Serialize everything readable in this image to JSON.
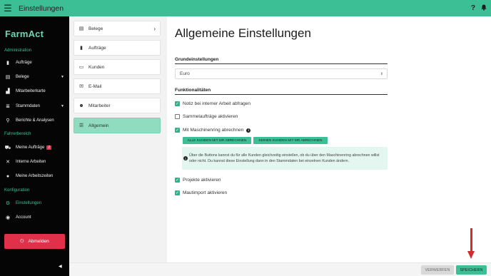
{
  "topbar": {
    "title": "Einstellungen",
    "help": "?"
  },
  "sidebar": {
    "logo": "FarmAct",
    "sections": [
      {
        "label": "Administration"
      },
      {
        "label": "Fahrerbereich"
      },
      {
        "label": "Konfiguration"
      }
    ],
    "items": [
      {
        "label": "Aufträge",
        "icon": "clipboard-icon"
      },
      {
        "label": "Belege",
        "icon": "document-icon"
      },
      {
        "label": "Mitarbeiterkarte",
        "icon": "map-icon"
      },
      {
        "label": "Stammdaten",
        "icon": "list-icon"
      },
      {
        "label": "Berichte & Analysen",
        "icon": "search-icon"
      },
      {
        "label": "Meine Aufträge",
        "icon": "tractor-icon",
        "badge": "2"
      },
      {
        "label": "Interne Arbeiten",
        "icon": "tools-icon"
      },
      {
        "label": "Meine Arbeitszeiten",
        "icon": "user-clock-icon"
      },
      {
        "label": "Einstellungen",
        "icon": "gear-icon"
      },
      {
        "label": "Account",
        "icon": "account-icon"
      }
    ],
    "logout": "Abmelden"
  },
  "settings_nav": [
    {
      "label": "Belege",
      "icon": "document-icon"
    },
    {
      "label": "Aufträge",
      "icon": "clipboard-icon"
    },
    {
      "label": "Kunden",
      "icon": "id-card-icon"
    },
    {
      "label": "E-Mail",
      "icon": "mail-icon"
    },
    {
      "label": "Mitarbeiter",
      "icon": "users-icon"
    },
    {
      "label": "Allgemein",
      "icon": "sliders-icon"
    }
  ],
  "main": {
    "title": "Allgemeine Einstellungen",
    "grund_heading": "Grundeinstellungen",
    "currency": "Euro",
    "funk_heading": "Funktionalitäten",
    "options": [
      {
        "label": "Notiz bei interner Arbeit abfragen",
        "checked": true
      },
      {
        "label": "Sammelaufträge aktivieren",
        "checked": false
      },
      {
        "label": "Mit Maschinenring abrechnen",
        "checked": true
      },
      {
        "label": "Projekte aktivieren",
        "checked": true
      },
      {
        "label": "Mautimport aktivieren",
        "checked": true
      }
    ],
    "btn_all": "ALLE KUNDEN MIT MR ABRECHNEN",
    "btn_none": "KEINEN KUNDEN MIT MR ABRECHNEN",
    "info_text": "Über die Buttons kannst du für alle Kunden gleichzeitig einstellen, ob du über den Maschinenring abrechnen willst oder nicht. Du kannst diese Einstellung dann in den Stammdaten bei einzelnen Kunden ändern."
  },
  "footer": {
    "discard": "VERWERFEN",
    "save": "SPEICHERN"
  },
  "colors": {
    "accent": "#3dbf95",
    "danger": "#e0304a",
    "annotation": "#d42b2b"
  }
}
